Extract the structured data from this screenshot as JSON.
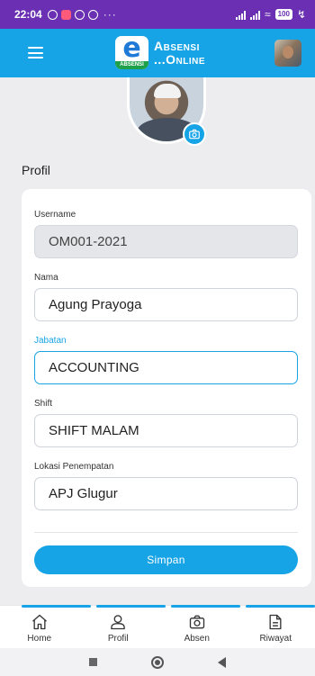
{
  "status_bar": {
    "time": "22:04",
    "dots": "···",
    "battery": "100"
  },
  "app_bar": {
    "logo_letter": "e",
    "logo_strip": "ABSENSI",
    "title_line1": "Absensi",
    "title_line2": "...Online"
  },
  "profile": {
    "section_title": "Profil",
    "fields": [
      {
        "label": "Username",
        "value": "OM001-2021",
        "state": "readonly"
      },
      {
        "label": "Nama",
        "value": "Agung Prayoga",
        "state": "normal"
      },
      {
        "label": "Jabatan",
        "value": "ACCOUNTING",
        "state": "focused"
      },
      {
        "label": "Shift",
        "value": "SHIFT MALAM",
        "state": "normal"
      },
      {
        "label": "Lokasi Penempatan",
        "value": "APJ Glugur",
        "state": "normal"
      }
    ],
    "save_label": "Simpan"
  },
  "bottom_nav": {
    "items": [
      {
        "label": "Home",
        "icon": "home-icon"
      },
      {
        "label": "Profil",
        "icon": "user-icon"
      },
      {
        "label": "Absen",
        "icon": "camera-icon"
      },
      {
        "label": "Riwayat",
        "icon": "document-icon"
      }
    ]
  },
  "colors": {
    "status_bar": "#6a2fb3",
    "primary": "#17a4e6",
    "background": "#ededf0"
  }
}
